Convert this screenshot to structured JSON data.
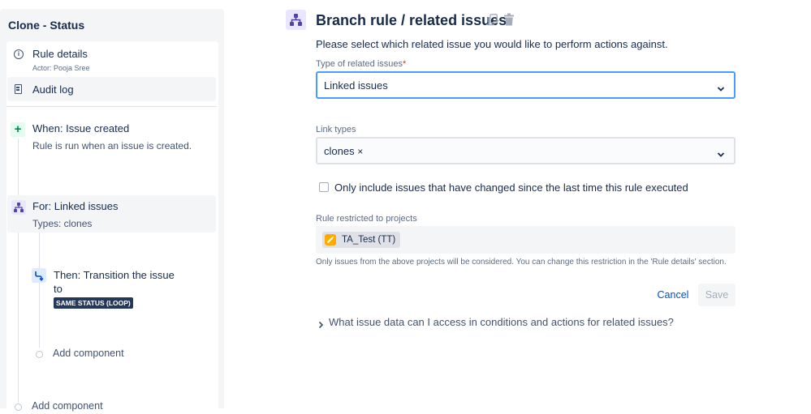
{
  "sidebar": {
    "title": "Clone - Status",
    "rule_details": {
      "label": "Rule details",
      "actor": "Actor: Pooja Sree"
    },
    "audit_log": {
      "label": "Audit log"
    },
    "trigger": {
      "label": "When: Issue created",
      "description": "Rule is run when an issue is created."
    },
    "branch": {
      "label": "For: Linked issues",
      "description": "Types: clones"
    },
    "action": {
      "label": "Then: Transition the issue to",
      "badge": "SAME STATUS (LOOP)"
    },
    "add_component_inner": "Add component",
    "add_component_outer": "Add component"
  },
  "panel": {
    "title": "Branch rule / related issues",
    "intro": "Please select which related issue you would like to perform actions against.",
    "type_field": {
      "label": "Type of related issues",
      "required_mark": "*",
      "value": "Linked issues"
    },
    "link_types_field": {
      "label": "Link types",
      "value": "clones",
      "remove_glyph": "×"
    },
    "checkbox": {
      "label": "Only include issues that have changed since the last time this rule executed",
      "checked": false
    },
    "projects_field": {
      "label": "Rule restricted to projects",
      "project": "TA_Test (TT)"
    },
    "help_text": "Only issues from the above projects will be considered. You can change this restriction in the 'Rule details' section.",
    "cancel_label": "Cancel",
    "save_label": "Save",
    "faq_label": "What issue data can I access in conditions and actions for related issues?"
  },
  "colors": {
    "accent": "#0052cc",
    "focus_border": "#4c9aff",
    "trigger_green": "#00875a",
    "branch_purple": "#5243aa",
    "badge_dark": "#253858",
    "project_icon": "#ffab00"
  },
  "icons": {
    "rule_details": "info-icon",
    "audit_log": "document-icon",
    "trigger": "plus-icon",
    "branch": "branch-icon",
    "action": "transition-icon",
    "header": "branch-icon",
    "copy": "copy-icon",
    "delete": "trash-icon"
  }
}
